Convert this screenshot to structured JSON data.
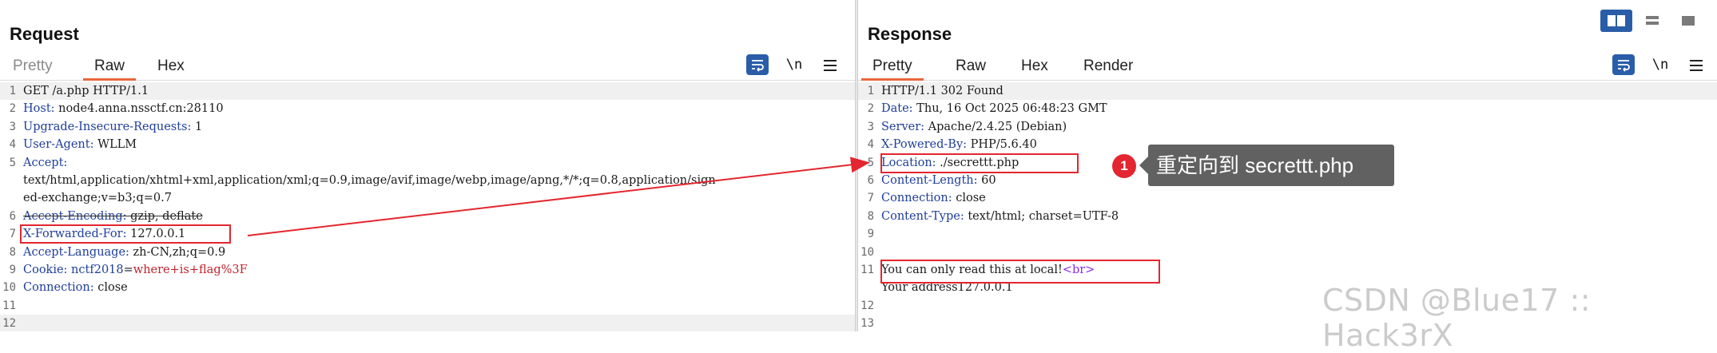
{
  "request": {
    "title": "Request",
    "tabs": [
      "Pretty",
      "Raw",
      "Hex"
    ],
    "active_tab": "Raw",
    "newline_label": "\\n",
    "lines": [
      {
        "n": "1",
        "parts": [
          {
            "t": "GET /a.php HTTP/1.1",
            "c": "plain"
          }
        ]
      },
      {
        "n": "2",
        "parts": [
          {
            "t": "Host:",
            "c": "key"
          },
          {
            "t": " node4.anna.nssctf.cn:28110",
            "c": "plain"
          }
        ]
      },
      {
        "n": "3",
        "parts": [
          {
            "t": "Upgrade-Insecure-Requests:",
            "c": "key"
          },
          {
            "t": " 1",
            "c": "plain"
          }
        ]
      },
      {
        "n": "4",
        "parts": [
          {
            "t": "User-Agent:",
            "c": "key"
          },
          {
            "t": " WLLM",
            "c": "plain"
          }
        ]
      },
      {
        "n": "5",
        "parts": [
          {
            "t": "Accept:",
            "c": "key"
          }
        ]
      },
      {
        "n": "",
        "parts": [
          {
            "t": "text/html,application/xhtml+xml,application/xml;q=0.9,image/avif,image/webp,image/apng,*/*;q=0.8,application/sign",
            "c": "plain"
          }
        ]
      },
      {
        "n": "",
        "parts": [
          {
            "t": "ed-exchange;v=b3;q=0.7",
            "c": "plain"
          }
        ]
      },
      {
        "n": "6",
        "parts": [
          {
            "t": "Accept-Encoding:",
            "c": "key"
          },
          {
            "t": " gzip, deflate",
            "c": "plain"
          }
        ]
      },
      {
        "n": "7",
        "parts": [
          {
            "t": "X-Forwarded-For:",
            "c": "key"
          },
          {
            "t": " 127.0.0.1",
            "c": "plain"
          }
        ]
      },
      {
        "n": "8",
        "parts": [
          {
            "t": "Accept-Language:",
            "c": "key"
          },
          {
            "t": " zh-CN,zh;q=0.9",
            "c": "plain"
          }
        ]
      },
      {
        "n": "9",
        "parts": [
          {
            "t": "Cookie:",
            "c": "key"
          },
          {
            "t": " nctf2018",
            "c": "key"
          },
          {
            "t": "=",
            "c": "plain"
          },
          {
            "t": "where+is+flag%3F",
            "c": "red"
          }
        ]
      },
      {
        "n": "10",
        "parts": [
          {
            "t": "Connection:",
            "c": "key"
          },
          {
            "t": " close",
            "c": "plain"
          }
        ]
      },
      {
        "n": "11",
        "parts": []
      },
      {
        "n": "12",
        "parts": []
      }
    ]
  },
  "response": {
    "title": "Response",
    "tabs": [
      "Pretty",
      "Raw",
      "Hex",
      "Render"
    ],
    "active_tab": "Pretty",
    "newline_label": "\\n",
    "lines": [
      {
        "n": "1",
        "parts": [
          {
            "t": "HTTP/1.1 302 Found",
            "c": "plain"
          }
        ]
      },
      {
        "n": "2",
        "parts": [
          {
            "t": "Date:",
            "c": "key"
          },
          {
            "t": " Thu, 16 Oct 2025 06:48:23 GMT",
            "c": "plain"
          }
        ]
      },
      {
        "n": "3",
        "parts": [
          {
            "t": "Server:",
            "c": "key"
          },
          {
            "t": " Apache/2.4.25 (Debian)",
            "c": "plain"
          }
        ]
      },
      {
        "n": "4",
        "parts": [
          {
            "t": "X-Powered-By:",
            "c": "key"
          },
          {
            "t": " PHP/5.6.40",
            "c": "plain"
          }
        ]
      },
      {
        "n": "5",
        "parts": [
          {
            "t": "Location:",
            "c": "key"
          },
          {
            "t": " ./secrettt.php",
            "c": "plain"
          }
        ]
      },
      {
        "n": "6",
        "parts": [
          {
            "t": "Content-Length:",
            "c": "key"
          },
          {
            "t": " 60",
            "c": "plain"
          }
        ]
      },
      {
        "n": "7",
        "parts": [
          {
            "t": "Connection:",
            "c": "key"
          },
          {
            "t": " close",
            "c": "plain"
          }
        ]
      },
      {
        "n": "8",
        "parts": [
          {
            "t": "Content-Type:",
            "c": "key"
          },
          {
            "t": " text/html; charset=UTF-8",
            "c": "plain"
          }
        ]
      },
      {
        "n": "9",
        "parts": []
      },
      {
        "n": "10",
        "parts": []
      },
      {
        "n": "11",
        "parts": [
          {
            "t": "You can only read this at local!",
            "c": "plain"
          },
          {
            "t": "<br>",
            "c": "purple"
          }
        ]
      },
      {
        "n": "",
        "parts": [
          {
            "t": "Your address127.0.0.1",
            "c": "plain"
          }
        ]
      },
      {
        "n": "12",
        "parts": []
      },
      {
        "n": "13",
        "parts": []
      }
    ]
  },
  "annotation": {
    "badge": "1",
    "callout": "重定向到 secrettt.php"
  },
  "watermark": "CSDN @Blue17 :: Hack3rX",
  "colors": {
    "accent": "#2a5da8",
    "tab_underline": "#e8663b",
    "annotation_red": "#e3262f",
    "header_key": "#1f3e9a"
  }
}
